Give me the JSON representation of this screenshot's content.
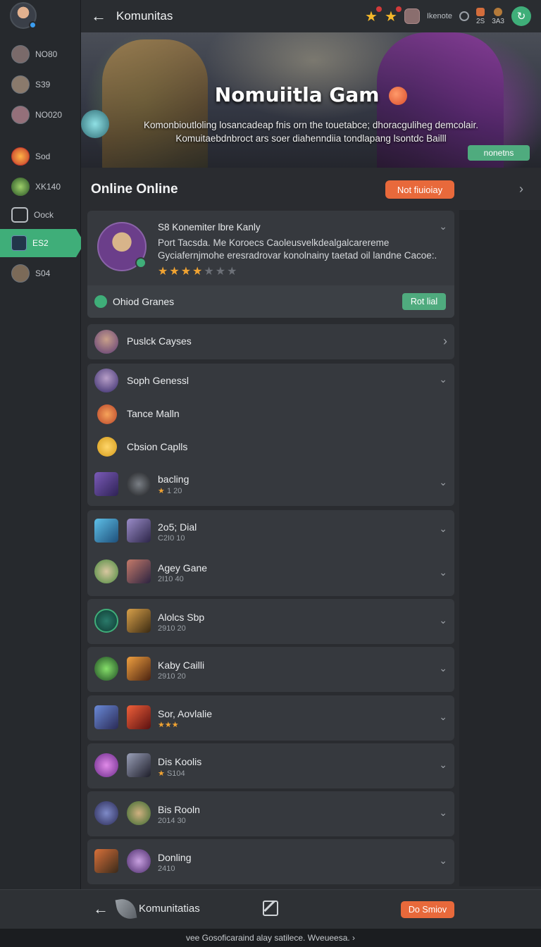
{
  "rail": {
    "items": [
      {
        "label": "NO80"
      },
      {
        "label": "S39"
      },
      {
        "label": "NO020"
      },
      {
        "label": "Sod"
      },
      {
        "label": "XK140"
      },
      {
        "label": "Oock"
      },
      {
        "label": "ES2"
      },
      {
        "label": "S04"
      }
    ]
  },
  "header": {
    "title": "Komunitas",
    "user_label": "Ikenote",
    "stat1": "2S",
    "stat2": "3A3"
  },
  "hero": {
    "title": "Nomuiitla Gam",
    "description_line1": "Komonbioutloling losancadeap fnis orn the touetabce; dhoracguliheg demcolair.",
    "description_line2": "Komuitaebdnbroct ars soer diahenndiia tondlapang lsontdc Bailll",
    "button": "nonetns"
  },
  "online": {
    "title": "Online Online",
    "button": "Not fiuioiay"
  },
  "featured": {
    "name": "S8 Konemiter lbre Kanly",
    "description": "Port Tacsda. Me Koroecs Caoleusvelkdealgalcarereme Gyciafernjmohe eresradrovar konolnainy taetad oil landne Cacoe:.",
    "rating": 4,
    "rating_max": 7,
    "footer_label": "Ohiod Granes",
    "footer_button": "Rot lial"
  },
  "rows": [
    {
      "name": "Puslck Cayses"
    },
    {
      "name": "Soph Genessl"
    },
    {
      "name": "Tance Malln"
    },
    {
      "name": "Cbsion Caplls"
    },
    {
      "name": "bacling",
      "sub": "1 20"
    },
    {
      "name": "2o5; Dial",
      "sub": "C2I0 10"
    },
    {
      "name": "Agey Gane",
      "sub": "2I10 40"
    },
    {
      "name": "Alolcs Sbp",
      "sub": "2910 20"
    },
    {
      "name": "Kaby Cailli",
      "sub": "2910 20"
    },
    {
      "name": "Sor, Aovlalie",
      "sub": ""
    },
    {
      "name": "Dis Koolis",
      "sub": "S104"
    },
    {
      "name": "Bis Rooln",
      "sub": "2014 30"
    },
    {
      "name": "Donling",
      "sub": "2410"
    }
  ],
  "bottom": {
    "title": "Komunitatias",
    "button": "Do Smiov"
  },
  "footer": {
    "text": "vee Gosoficaraind alay satilece. Wveueesa. ›"
  },
  "icons": {
    "back": "arrow-left-icon",
    "chevron": "chevron-down-icon",
    "edit": "edit-icon"
  },
  "colors": {
    "accent_green": "#3fae79",
    "accent_orange": "#e8693b",
    "star": "#f0a332"
  }
}
